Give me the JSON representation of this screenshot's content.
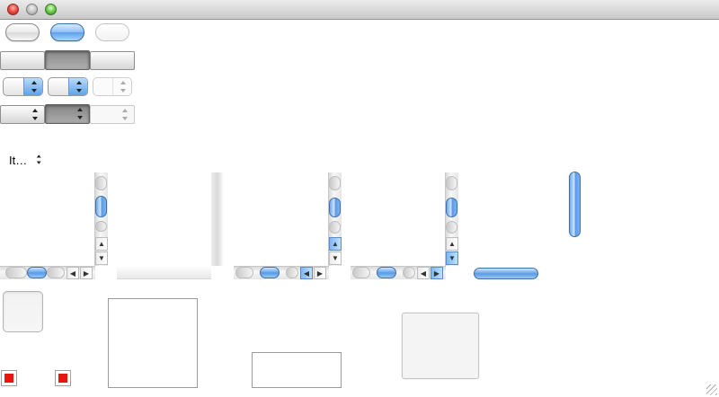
{
  "window": {
    "title": "",
    "traffic_lights": {
      "close_color": "#e2443a",
      "minimize_color": "#bcbcbc",
      "zoom_color": "#62c43f"
    }
  },
  "item_popup": {
    "label": "It…",
    "icon": "up-down-arrows-icon"
  },
  "scrollbars": {
    "up_arrow": "▲",
    "down_arrow": "▼",
    "left_arrow": "◀",
    "right_arrow": "▶"
  },
  "colors": {
    "accent": "#5ea0e8",
    "marker": "#e8160e"
  }
}
